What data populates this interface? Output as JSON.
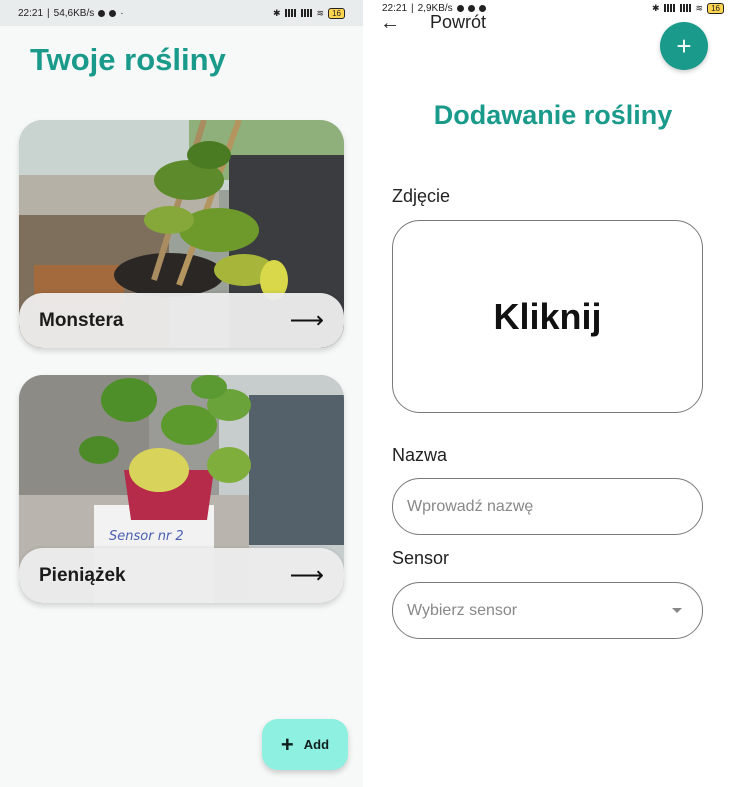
{
  "left": {
    "status": {
      "time": "22:21",
      "speed": "54,6KB/s",
      "battery": "16"
    },
    "title": "Twoje rośliny",
    "plants": [
      {
        "name": "Monstera"
      },
      {
        "name": "Pieniążek",
        "note_text": "Sensor nr 2"
      }
    ],
    "add_button": {
      "icon": "plus-icon",
      "label": "Add"
    }
  },
  "right": {
    "status": {
      "time": "22:21",
      "speed": "2,9KB/s",
      "battery": "16"
    },
    "back_icon": "arrow-left-icon",
    "back_label": "Powrót",
    "fab_icon": "plus-icon",
    "title": "Dodawanie rośliny",
    "photo_label": "Zdjęcie",
    "photo_placeholder": "Kliknij",
    "name_label": "Nazwa",
    "name_placeholder": "Wprowadź nazwę",
    "sensor_label": "Sensor",
    "sensor_placeholder": "Wybierz sensor"
  },
  "colors": {
    "accent": "#1a9a8a",
    "fab_light": "#8ef0e0",
    "card_bar": "#ececec"
  }
}
